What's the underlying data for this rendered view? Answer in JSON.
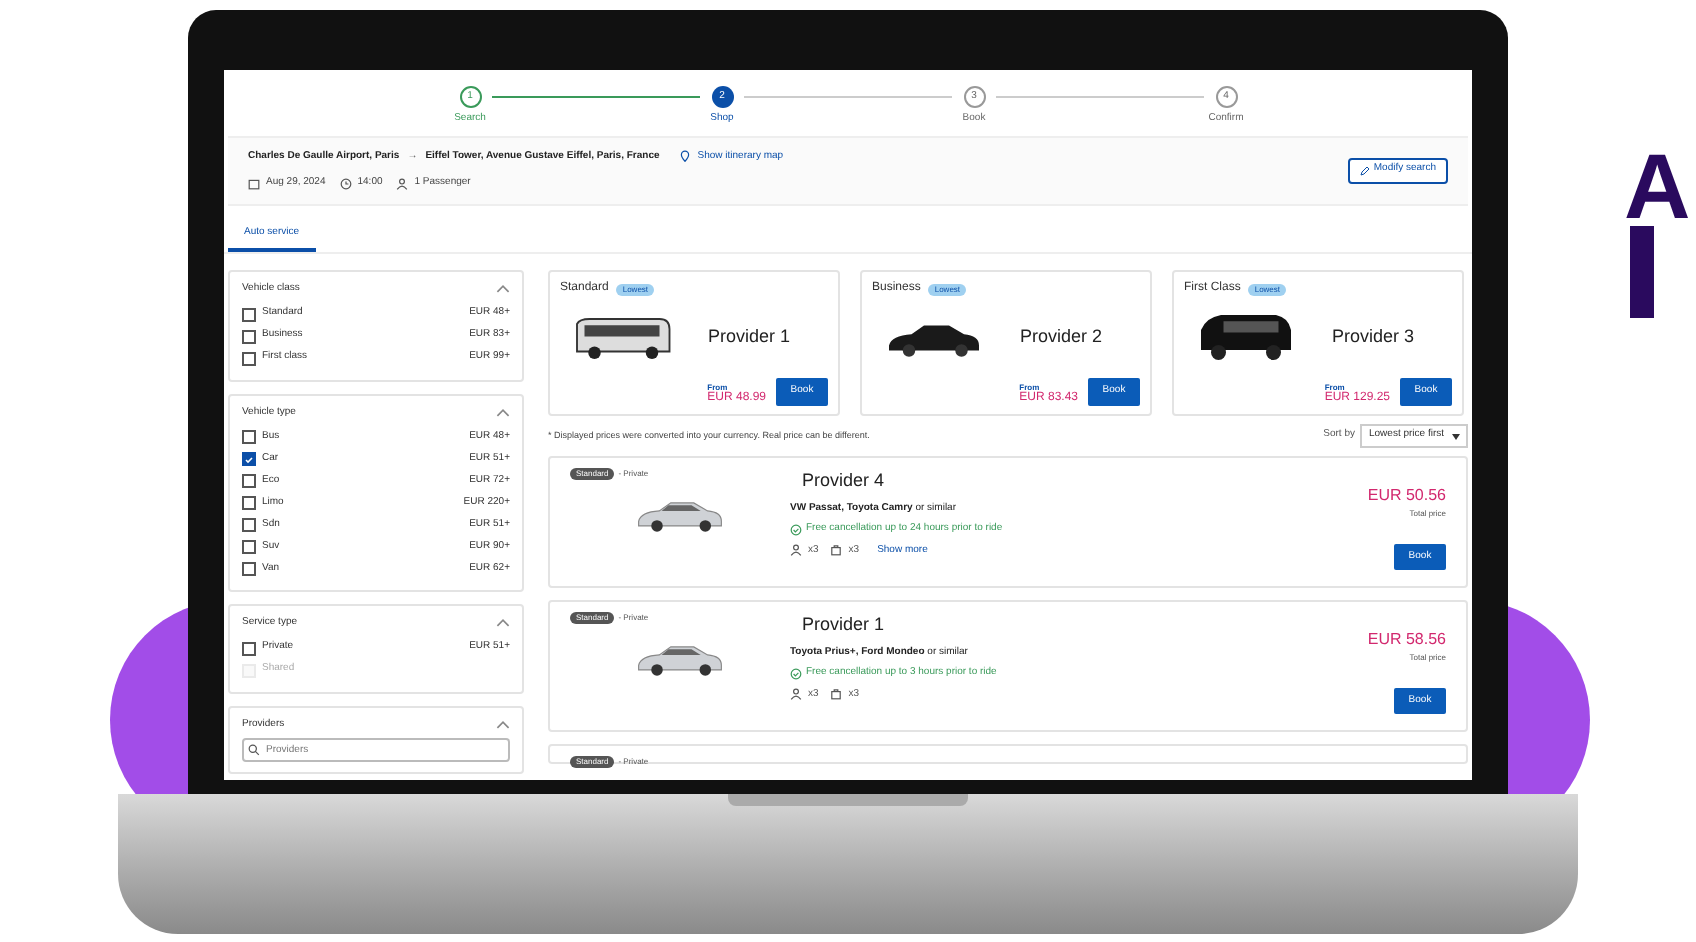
{
  "stepper": [
    {
      "number": "1",
      "label": "Search",
      "kind": "done"
    },
    {
      "number": "2",
      "label": "Shop",
      "kind": "current"
    },
    {
      "number": "3",
      "label": "Book",
      "kind": "todo"
    },
    {
      "number": "4",
      "label": "Confirm",
      "kind": "todo"
    }
  ],
  "trip": {
    "from": "Charles De Gaulle Airport, Paris",
    "arrow": "→",
    "to": "Eiffel Tower, Avenue Gustave Eiffel, Paris, France",
    "map_link": "Show itinerary map",
    "date": "Aug 29, 2024",
    "time": "14:00",
    "passengers": "1 Passenger",
    "modify_button": "Modify search"
  },
  "tabs": [
    {
      "label": "Auto service",
      "selected": true
    }
  ],
  "filters": [
    {
      "title": "Vehicle class",
      "expanded": true,
      "options": [
        {
          "label": "Standard",
          "price": "EUR 48+",
          "checked": false,
          "disabled": false
        },
        {
          "label": "Business",
          "price": "EUR 83+",
          "checked": false,
          "disabled": false
        },
        {
          "label": "First class",
          "price": "EUR 99+",
          "checked": false,
          "disabled": false
        }
      ]
    },
    {
      "title": "Vehicle type",
      "expanded": true,
      "options": [
        {
          "label": "Bus",
          "price": "EUR 48+",
          "checked": false,
          "disabled": false
        },
        {
          "label": "Car",
          "price": "EUR 51+",
          "checked": true,
          "disabled": false
        },
        {
          "label": "Eco",
          "price": "EUR 72+",
          "checked": false,
          "disabled": false
        },
        {
          "label": "Limo",
          "price": "EUR 220+",
          "checked": false,
          "disabled": false
        },
        {
          "label": "Sdn",
          "price": "EUR 51+",
          "checked": false,
          "disabled": false
        },
        {
          "label": "Suv",
          "price": "EUR 90+",
          "checked": false,
          "disabled": false
        },
        {
          "label": "Van",
          "price": "EUR 62+",
          "checked": false,
          "disabled": false
        }
      ]
    },
    {
      "title": "Service type",
      "expanded": true,
      "options": [
        {
          "label": "Private",
          "price": "EUR 51+",
          "checked": false,
          "disabled": false
        },
        {
          "label": "Shared",
          "checked": false,
          "disabled": true
        }
      ]
    },
    {
      "title": "Providers",
      "expanded": true,
      "search_placeholder": "Providers"
    }
  ],
  "featured": [
    {
      "class": "Standard",
      "badge": "Lowest",
      "kind": "bus",
      "provider": "Provider 1",
      "from": "From",
      "price": "EUR 48.99",
      "book": "Book"
    },
    {
      "class": "Business",
      "badge": "Lowest",
      "kind": "sedan",
      "provider": "Provider 2",
      "from": "From",
      "price": "EUR 83.43",
      "book": "Book"
    },
    {
      "class": "First Class",
      "badge": "Lowest",
      "kind": "van",
      "provider": "Provider 3",
      "from": "From",
      "price": "EUR 129.25",
      "book": "Book"
    }
  ],
  "note": "* Displayed prices were converted into your currency. Real price can be different.",
  "sort": {
    "label": "Sort by",
    "value": "Lowest price first"
  },
  "results": [
    {
      "badge": "Standard",
      "type": "- Private",
      "provider": "Provider 4",
      "vehicles": "VW Passat, Toyota Camry",
      "similar": "or similar",
      "cancellation": "Free cancellation up to 24 hours prior to ride",
      "passengers": "x3",
      "luggage": "x3",
      "more": "Show more",
      "price": "EUR 50.56",
      "price_label": "Total price",
      "book": "Book"
    },
    {
      "badge": "Standard",
      "type": "- Private",
      "provider": "Provider 1",
      "vehicles": "Toyota Prius+, Ford Mondeo",
      "similar": "or similar",
      "cancellation": "Free cancellation up to 3 hours prior to ride",
      "passengers": "x3",
      "luggage": "x3",
      "price": "EUR 58.56",
      "price_label": "Total price",
      "book": "Book"
    },
    {
      "badge": "Standard",
      "type": "- Private"
    }
  ],
  "side_heading": "A"
}
